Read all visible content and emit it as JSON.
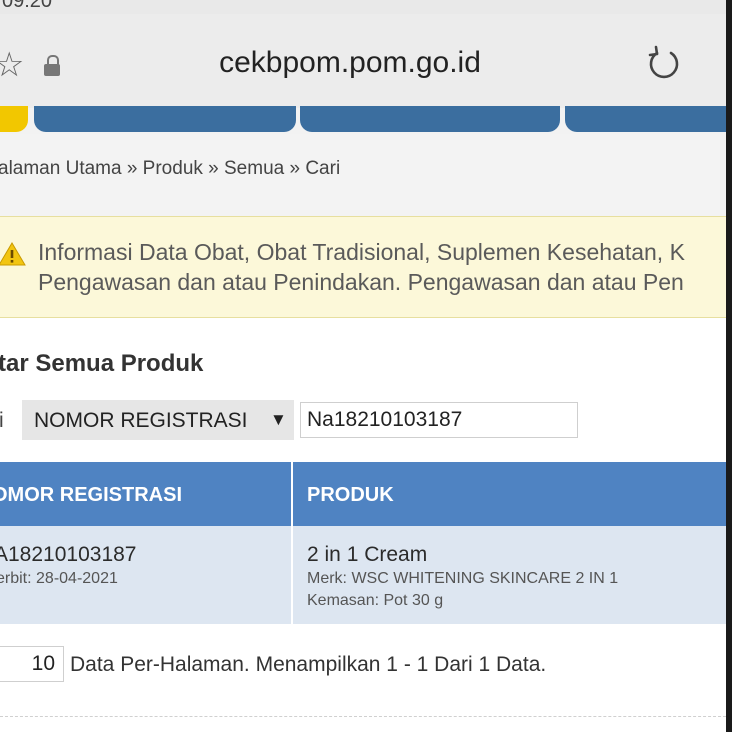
{
  "browser": {
    "status_time": "09:20",
    "url": "cekbpom.pom.go.id"
  },
  "breadcrumb": "alaman Utama » Produk » Semua » Cari",
  "alert": {
    "line1": "Informasi Data Obat, Obat Tradisional, Suplemen Kesehatan, K",
    "line2": "Pengawasan dan atau Penindakan. Pengawasan dan atau Pen"
  },
  "page_title": "ftar Semua Produk",
  "search": {
    "label": "ri",
    "field_selected": "NOMOR REGISTRASI",
    "query": "Na18210103187"
  },
  "table": {
    "headers": [
      "OMOR REGISTRASI",
      "PRODUK"
    ],
    "rows": [
      {
        "nomor": "A18210103187",
        "terbit": "erbit: 28-04-2021",
        "produk": "2 in 1 Cream",
        "merk": "Merk: WSC WHITENING SKINCARE 2 IN 1",
        "kemasan": "Kemasan: Pot 30 g"
      }
    ]
  },
  "pagination": {
    "per_page": "10",
    "summary": "Data Per-Halaman. Menampilkan 1 - 1 Dari 1 Data."
  },
  "colors": {
    "header_blue": "#4f83c2",
    "nav_blue": "#3b6e9f",
    "row_blue": "#dde6f1",
    "alert_yellow": "#fcf8d9"
  }
}
